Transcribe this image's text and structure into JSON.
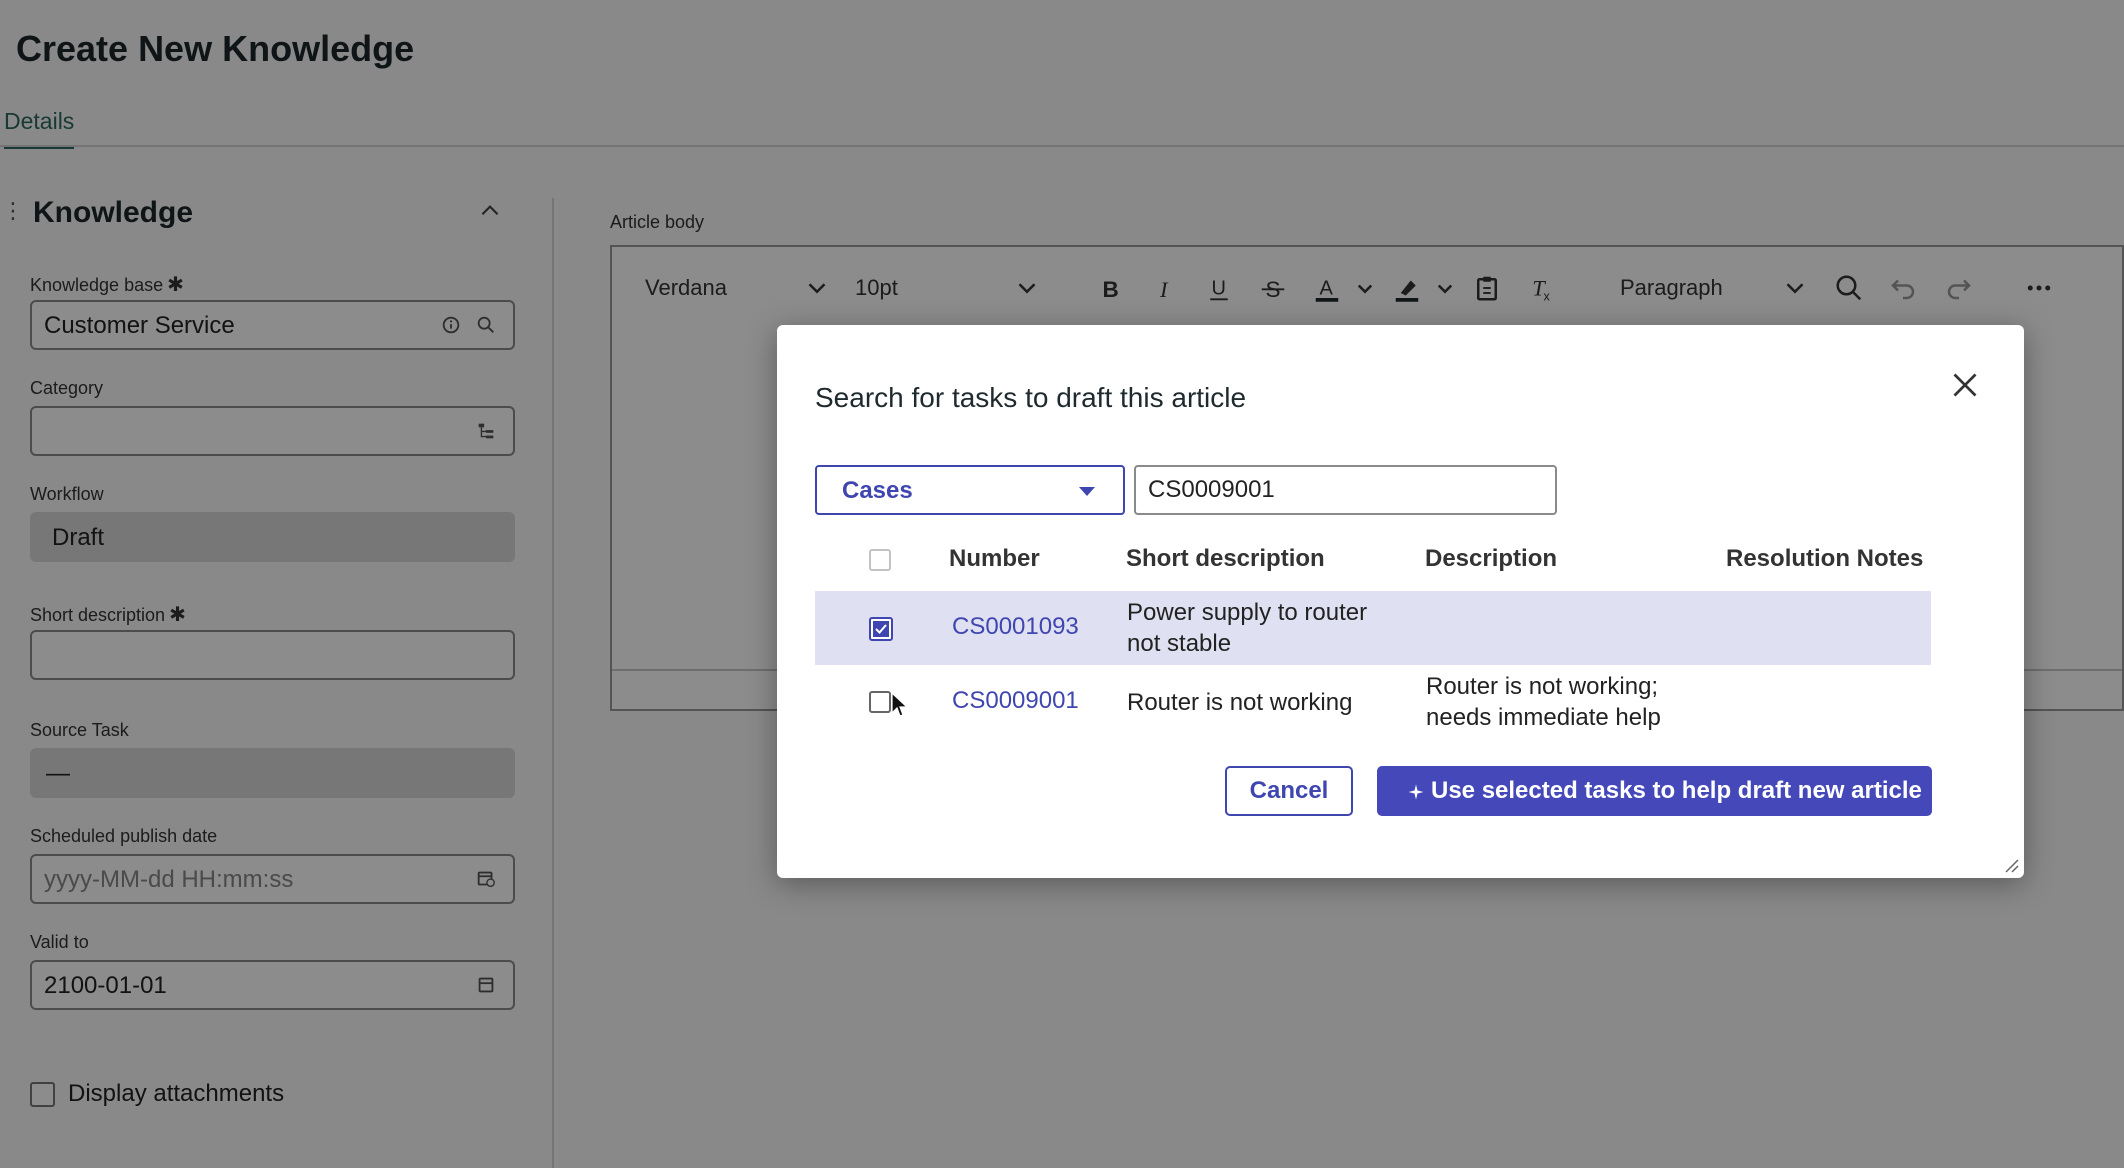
{
  "page": {
    "title": "Create New Knowledge",
    "tab_details": "Details"
  },
  "form": {
    "section_title": "Knowledge",
    "knowledge_base_label": "Knowledge base",
    "knowledge_base_value": "Customer Service",
    "required_mark": "✱",
    "category_label": "Category",
    "category_value": "",
    "workflow_label": "Workflow",
    "workflow_value": "Draft",
    "short_description_label": "Short description",
    "short_description_value": "",
    "source_task_label": "Source Task",
    "source_task_value": "—",
    "scheduled_publish_label": "Scheduled publish date",
    "scheduled_publish_placeholder": "yyyy-MM-dd HH:mm:ss",
    "valid_to_label": "Valid to",
    "valid_to_value": "2100-01-01",
    "display_attachments_label": "Display attachments"
  },
  "editor": {
    "label": "Article body",
    "font_family": "Verdana",
    "font_size": "10pt",
    "block_format": "Paragraph"
  },
  "modal": {
    "title": "Search for tasks to draft this article",
    "type_select_value": "Cases",
    "search_value": "CS0009001",
    "columns": [
      "Number",
      "Short description",
      "Description",
      "Resolution Notes"
    ],
    "rows": [
      {
        "selected": true,
        "number": "CS0001093",
        "short_description_line1": "Power supply to router",
        "short_description_line2": "not stable",
        "description_line1": "",
        "description_line2": "",
        "resolution_notes": ""
      },
      {
        "selected": false,
        "number": "CS0009001",
        "short_description_line1": "Router is not working",
        "short_description_line2": "",
        "description_line1": "Router is not working;",
        "description_line2": "needs immediate help",
        "resolution_notes": ""
      }
    ],
    "cancel_label": "Cancel",
    "primary_label": "Use selected tasks to help draft new article"
  },
  "colors": {
    "accent": "#4448b9",
    "link": "#3f46b0",
    "selected_row": "#dfe0f1",
    "tab_active": "#2e6b60"
  }
}
